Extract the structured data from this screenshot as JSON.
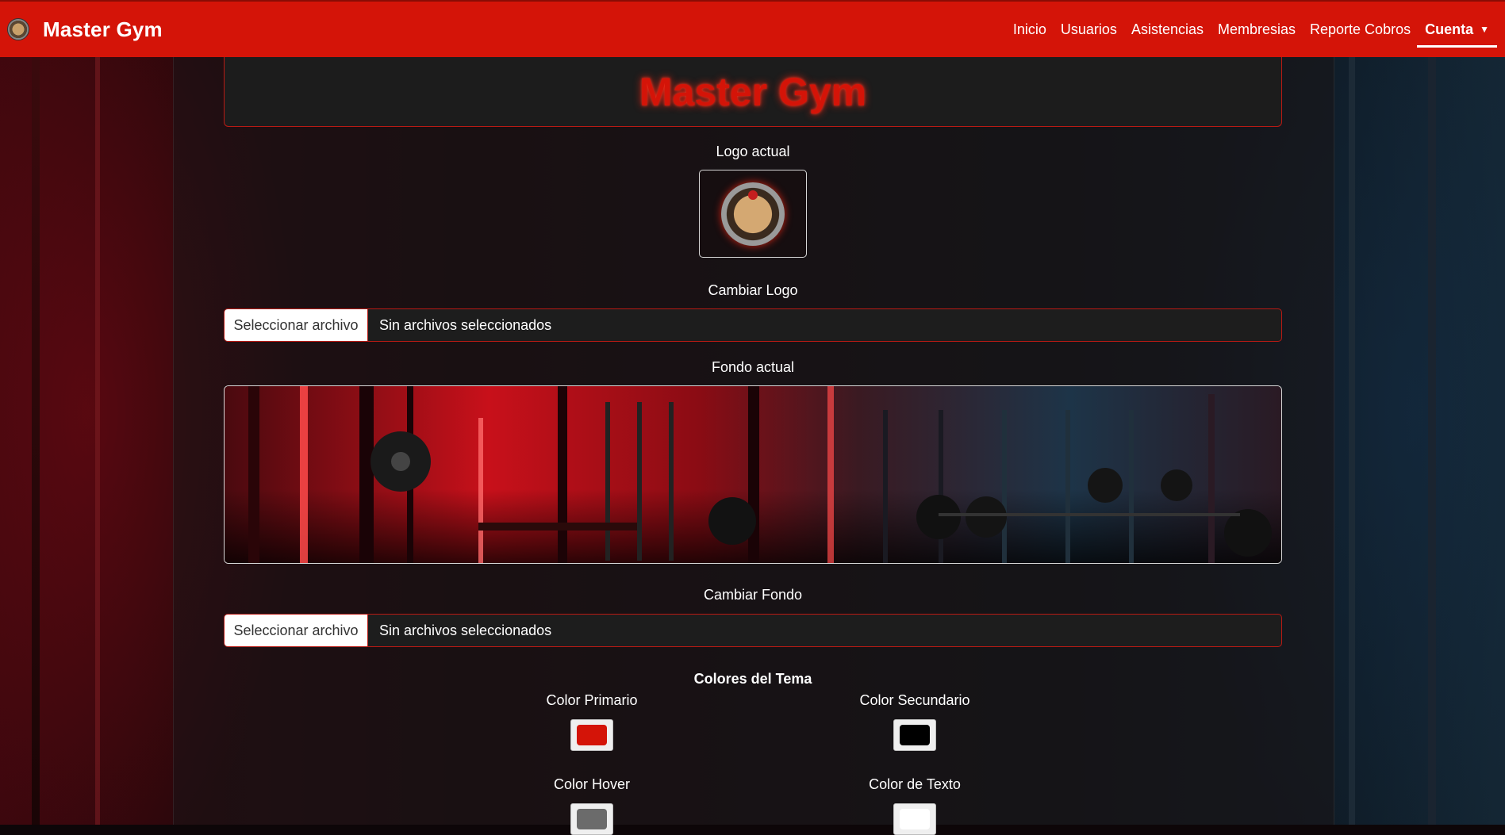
{
  "navbar": {
    "brand": "Master Gym",
    "links": [
      "Inicio",
      "Usuarios",
      "Asistencias",
      "Membresias",
      "Reporte Cobros"
    ],
    "account": "Cuenta"
  },
  "main": {
    "title": "Master Gym",
    "logo_label": "Logo actual",
    "change_logo_label": "Cambiar Logo",
    "logo_file": {
      "button": "Seleccionar archivo",
      "status": "Sin archivos seleccionados"
    },
    "background_label": "Fondo actual",
    "change_background_label": "Cambiar Fondo",
    "background_file": {
      "button": "Seleccionar archivo",
      "status": "Sin archivos seleccionados"
    },
    "theme_heading": "Colores del Tema",
    "colors": {
      "primary": {
        "label": "Color Primario",
        "value": "#d41408"
      },
      "secondary": {
        "label": "Color Secundario",
        "value": "#000000"
      },
      "hover": {
        "label": "Color Hover",
        "value": "#6b6b6b"
      },
      "text": {
        "label": "Color de Texto",
        "value": "#ffffff"
      }
    }
  }
}
